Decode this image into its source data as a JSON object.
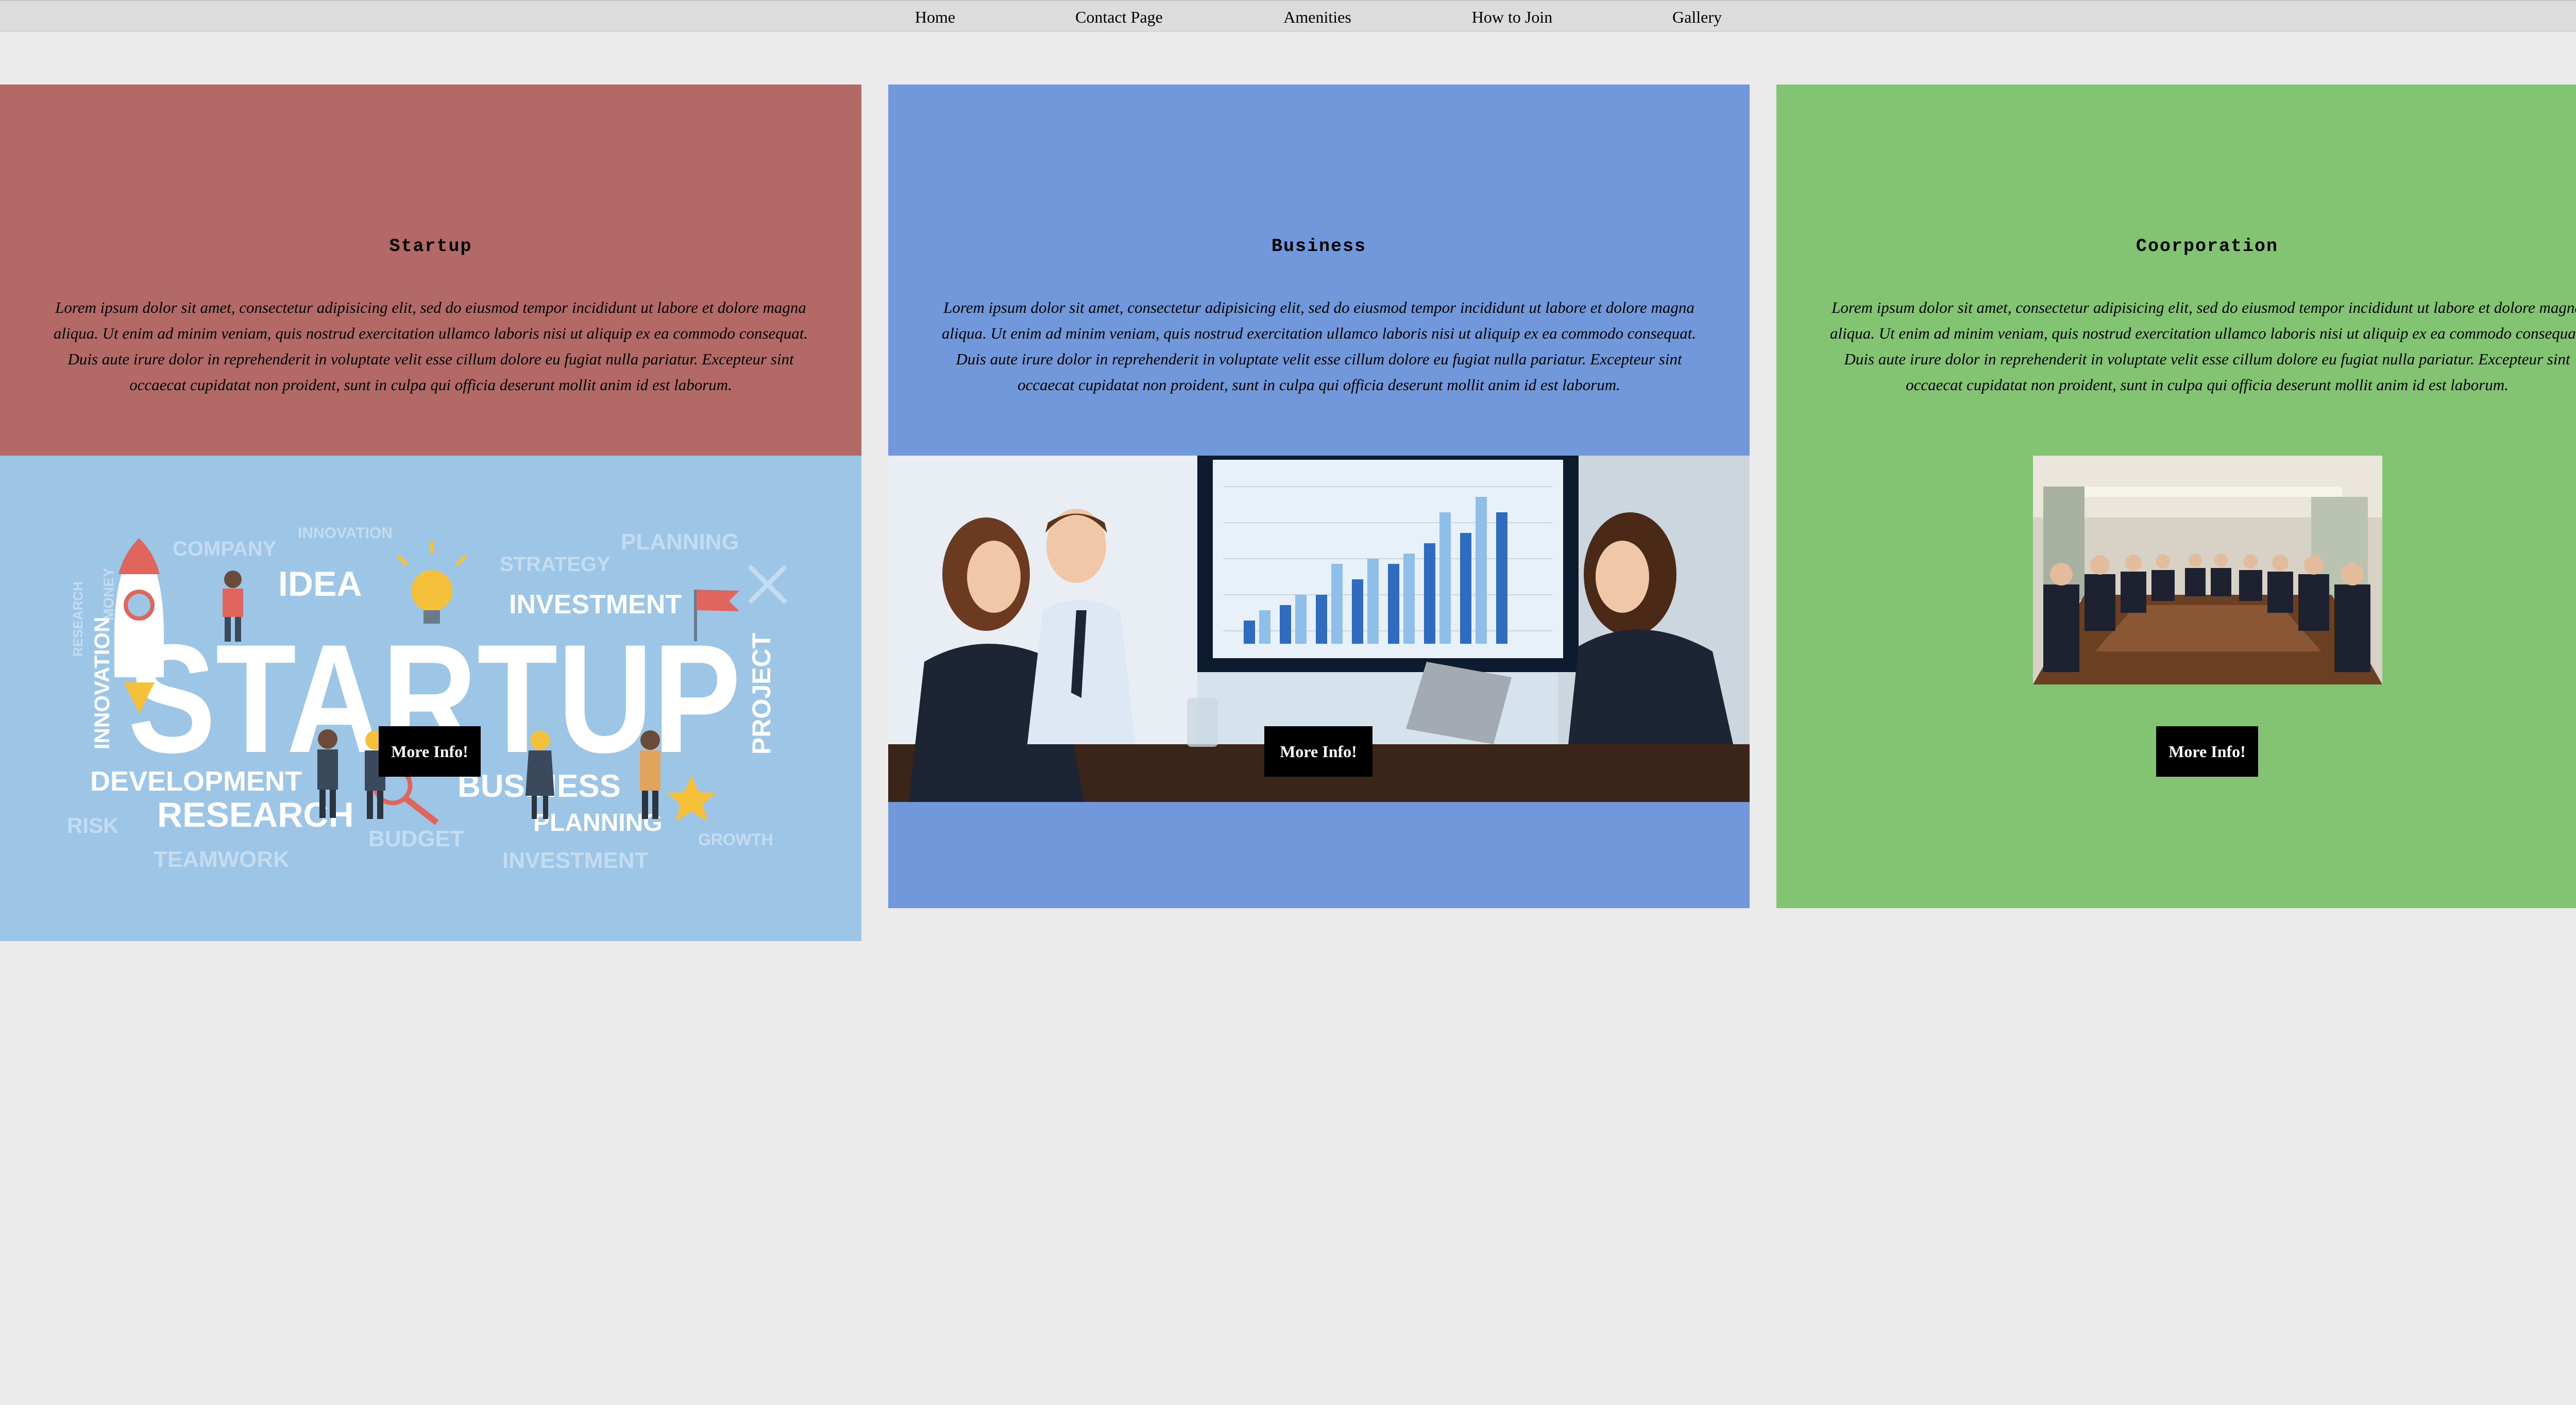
{
  "nav": {
    "items": [
      "Home",
      "Contact Page",
      "Amenities",
      "How to Join",
      "Gallery"
    ]
  },
  "cards": [
    {
      "title": "Startup",
      "description": "Lorem ipsum dolor sit amet, consectetur adipisicing elit, sed do eiusmod tempor incididunt ut labore et dolore magna aliqua. Ut enim ad minim veniam, quis nostrud exercitation ullamco laboris nisi ut aliquip ex ea commodo consequat. Duis aute irure dolor in reprehenderit in voluptate velit esse cillum dolore eu fugiat nulla pariatur. Excepteur sint occaecat cupidatat non proident, sunt in culpa qui officia deserunt mollit anim id est laborum.",
      "button": "More Info!",
      "color": "#b36a67",
      "image_words": {
        "big": "STARTUP",
        "idea": "IDEA",
        "investment": "INVESTMENT",
        "development": "DEVELOPMENT",
        "research": "RESEARCH",
        "business": "BUSINESS",
        "planning_bottom": "PLANNING",
        "innovation_side": "INNOVATION",
        "project": "PROJECT",
        "company": "COMPANY",
        "innovation_top": "INNOVATION",
        "strategy": "STRATEGY",
        "planning_top": "PLANNING",
        "budget": "BUDGET",
        "teamwork": "TEAMWORK",
        "investment_bottom": "INVESTMENT",
        "growth": "GROWTH",
        "risk": "RISK",
        "money": "MONEY",
        "research_side": "RESEARCH"
      }
    },
    {
      "title": "Business",
      "description": "Lorem ipsum dolor sit amet, consectetur adipisicing elit, sed do eiusmod tempor incididunt ut labore et dolore magna aliqua. Ut enim ad minim veniam, quis nostrud exercitation ullamco laboris nisi ut aliquip ex ea commodo consequat. Duis aute irure dolor in reprehenderit in voluptate velit esse cillum dolore eu fugiat nulla pariatur. Excepteur sint occaecat cupidatat non proident, sunt in culpa qui officia deserunt mollit anim id est laborum.",
      "button": "More Info!",
      "color": "#7098da"
    },
    {
      "title": "Coorporation",
      "description": "Lorem ipsum dolor sit amet, consectetur adipisicing elit, sed do eiusmod tempor incididunt ut labore et dolore magna aliqua. Ut enim ad minim veniam, quis nostrud exercitation ullamco laboris nisi ut aliquip ex ea commodo consequat. Duis aute irure dolor in reprehenderit in voluptate velit esse cillum dolore eu fugiat nulla pariatur. Excepteur sint occaecat cupidatat non proident, sunt in culpa qui officia deserunt mollit anim id est laborum.",
      "button": "More Info!",
      "color": "#83c472"
    }
  ],
  "colors": {
    "page_background": "#ebebeb",
    "navbar": "#dcdcdc",
    "startup_image_background": "#9dc6e6",
    "button": "#000000",
    "button_text": "#ffffff"
  }
}
